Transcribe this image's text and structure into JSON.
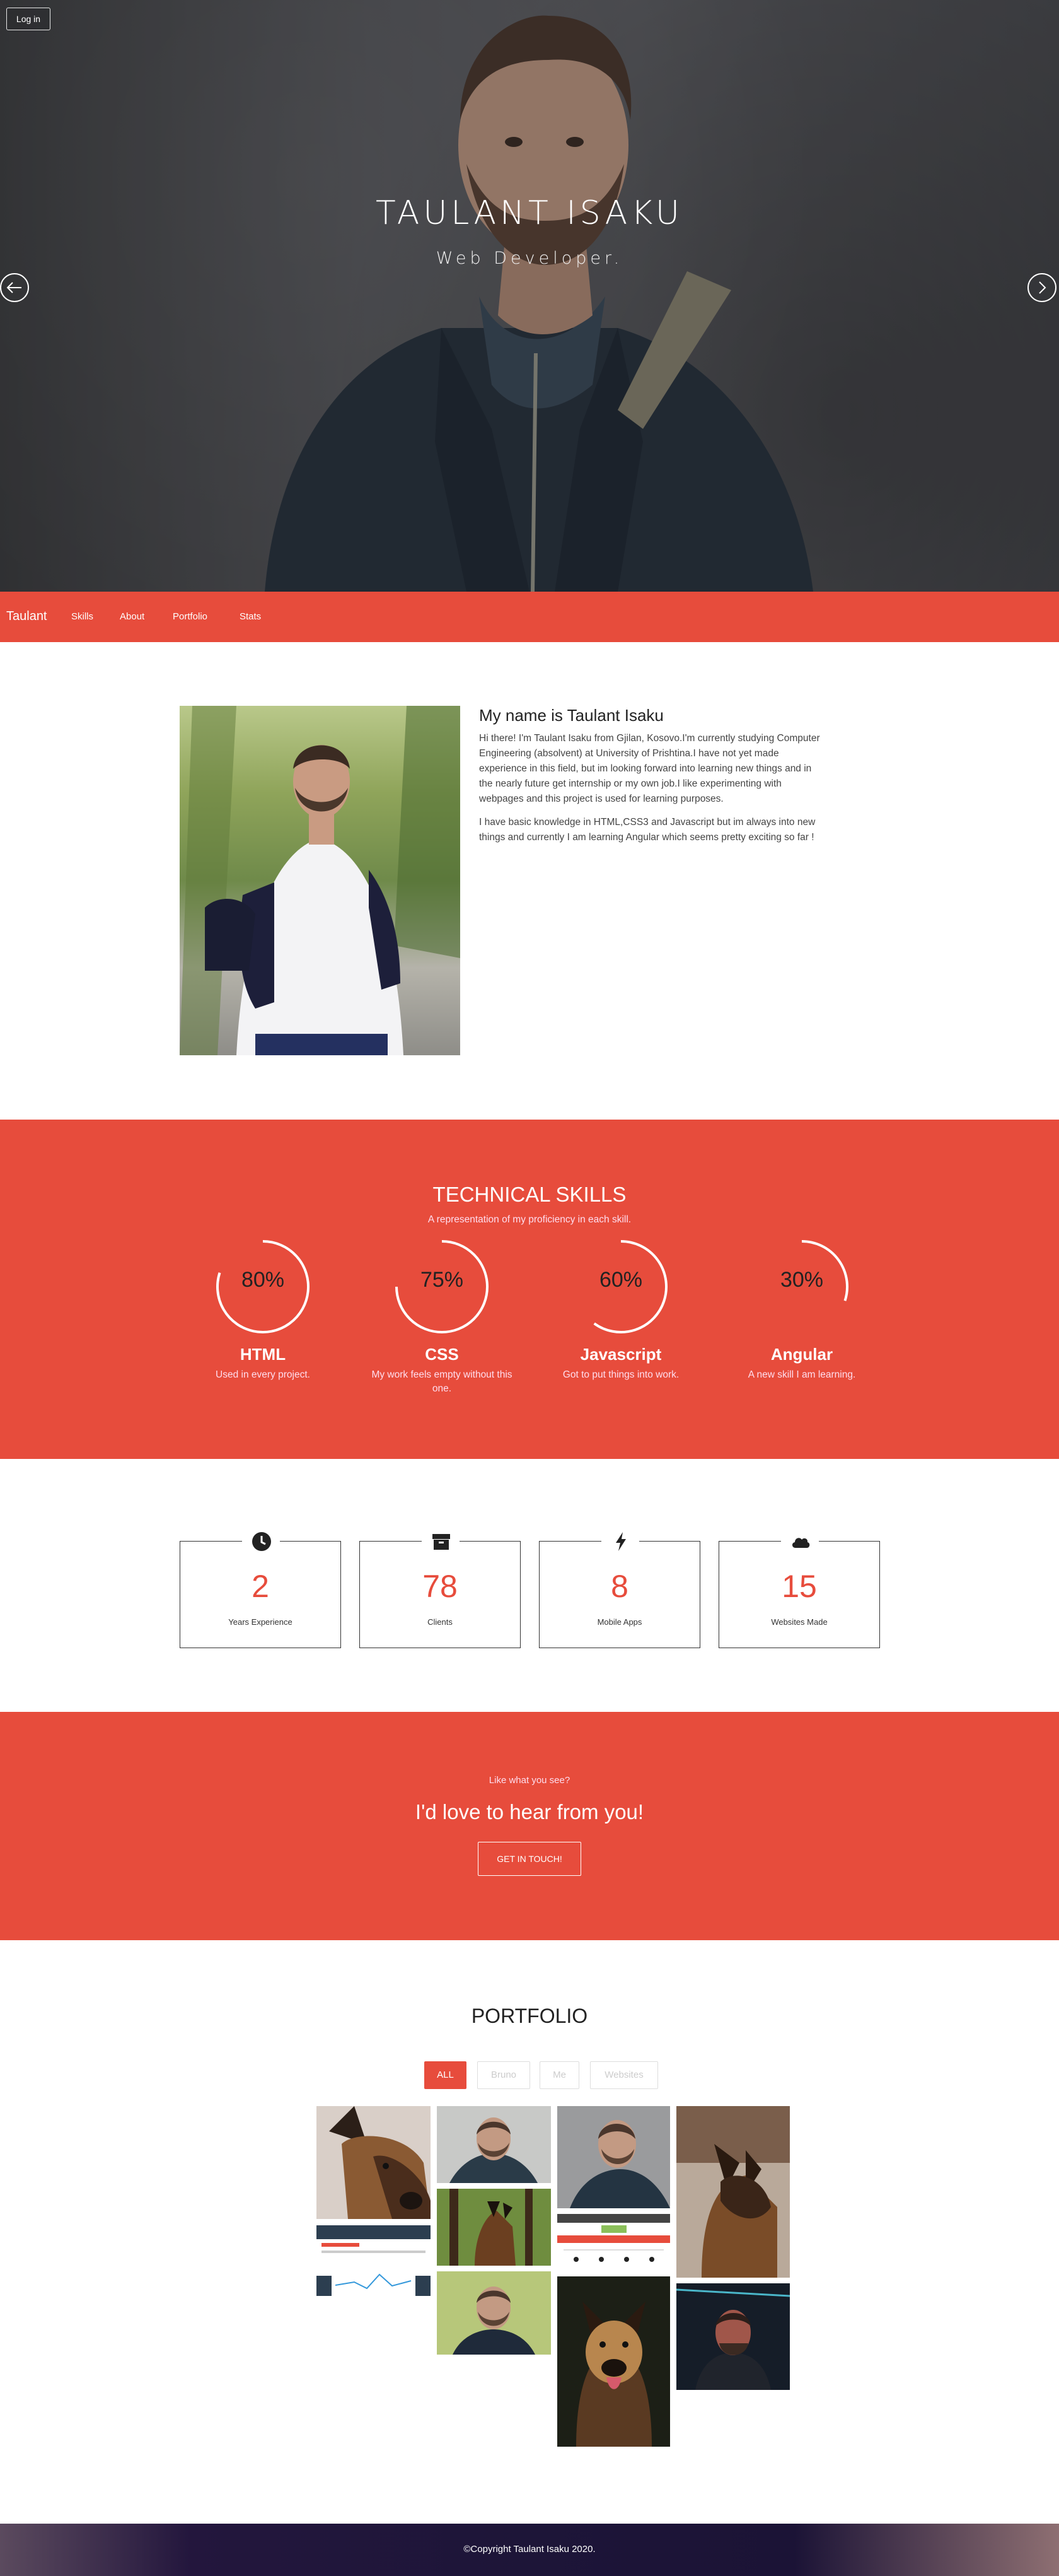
{
  "hero": {
    "title": "TAULANT ISAKU",
    "subtitle": "Web Developer.",
    "login_label": "Log in",
    "prev_icon": "arrow-left-circle-icon",
    "next_icon": "arrow-right-circle-icon"
  },
  "nav": {
    "brand": "Taulant",
    "items": [
      "Skills",
      "About",
      "Portfolio",
      "Stats"
    ]
  },
  "about": {
    "heading": "My name is Taulant Isaku",
    "p1_lines": [
      "Hi there! I'm Taulant Isaku from Gjilan, Kosovo.I'm currently studying Computer",
      "Engineering (absolvent) at University of Prishtina.I have not yet made",
      "experience in this field, but im looking forward into learning new things and in",
      "the nearly future get internship or my own job.I like experimenting with",
      "webpages and this project is used for learning purposes."
    ],
    "p2_lines": [
      "I have basic knowledge in HTML,CSS3 and Javascript but im always into new",
      "things and currently I am learning Angular which seems pretty exciting so far !"
    ]
  },
  "skills": {
    "title": "TECHNICAL SKILLS",
    "subtitle": "A representation of my proficiency in each skill.",
    "items": [
      {
        "percent_label": "80%",
        "value": 80,
        "name": "HTML",
        "desc": "Used in every project."
      },
      {
        "percent_label": "75%",
        "value": 75,
        "name": "CSS",
        "desc": "My work feels empty without this one."
      },
      {
        "percent_label": "60%",
        "value": 60,
        "name": "Javascript",
        "desc": "Got to put things into work."
      },
      {
        "percent_label": "30%",
        "value": 30,
        "name": "Angular",
        "desc": "A new skill I am learning."
      }
    ]
  },
  "stats": [
    {
      "icon": "clock-icon",
      "number": "2",
      "label": "Years Experience"
    },
    {
      "icon": "archive-box-icon",
      "number": "78",
      "label": "Clients"
    },
    {
      "icon": "lightning-bolt-icon",
      "number": "8",
      "label": "Mobile Apps"
    },
    {
      "icon": "cloud-icon",
      "number": "15",
      "label": "Websites Made"
    }
  ],
  "contact": {
    "small": "Like what you see?",
    "big": "I'd love to hear from you!",
    "button": "GET IN TOUCH!"
  },
  "portfolio": {
    "title": "PORTFOLIO",
    "filters": [
      "ALL",
      "Bruno",
      "Me",
      "Websites"
    ],
    "active_filter": "ALL"
  },
  "footer": {
    "text": "©Copyright Taulant Isaku 2020."
  },
  "colors": {
    "accent": "#e74c3c",
    "dark": "#222222"
  }
}
